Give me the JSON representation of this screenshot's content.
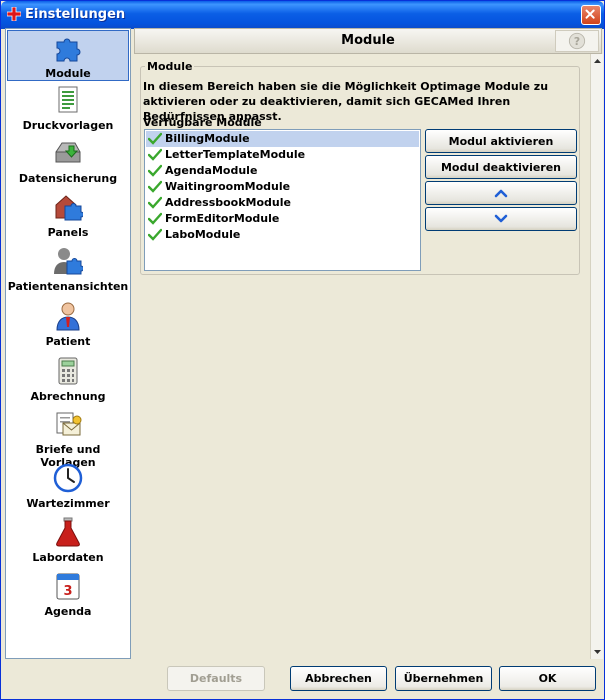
{
  "window": {
    "title": "Einstellungen"
  },
  "sidebar": {
    "items": [
      {
        "label": "Module",
        "icon": "puzzle-icon",
        "selected": true
      },
      {
        "label": "Druckvorlagen",
        "icon": "document-template-icon"
      },
      {
        "label": "Datensicherung",
        "icon": "backup-drive-icon"
      },
      {
        "label": "Panels",
        "icon": "panels-icon"
      },
      {
        "label": "Patientenansichten",
        "icon": "patient-views-icon"
      },
      {
        "label": "Patient",
        "icon": "patient-icon"
      },
      {
        "label": "Abrechnung",
        "icon": "calculator-icon"
      },
      {
        "label": "Briefe und Vorlagen",
        "icon": "letter-icon"
      },
      {
        "label": "Wartezimmer",
        "icon": "clock-icon"
      },
      {
        "label": "Labordaten",
        "icon": "flask-icon"
      },
      {
        "label": "Agenda",
        "icon": "calendar-icon"
      }
    ]
  },
  "header": {
    "title": "Module",
    "help_symbol": "?"
  },
  "module_section": {
    "legend": "Module",
    "description": "In diesem Bereich haben sie die Möglichkeit Optimage Module zu aktivieren oder zu deaktivieren, damit sich GECAMed Ihren Bedürfnissen anpasst.",
    "list_label": "Verfügbare Module",
    "modules": [
      {
        "name": "BillingModule",
        "active": true,
        "selected": true
      },
      {
        "name": "LetterTemplateModule",
        "active": true
      },
      {
        "name": "AgendaModule",
        "active": true
      },
      {
        "name": "WaitingroomModule",
        "active": true
      },
      {
        "name": "AddressbookModule",
        "active": true
      },
      {
        "name": "FormEditorModule",
        "active": true
      },
      {
        "name": "LaboModule",
        "active": true
      }
    ],
    "activate_label": "Modul aktivieren",
    "deactivate_label": "Modul deaktivieren"
  },
  "footer": {
    "defaults_label": "Defaults",
    "cancel_label": "Abbrechen",
    "apply_label": "Übernehmen",
    "ok_label": "OK"
  },
  "colors": {
    "titlebar": "#0453de",
    "selection": "#c1d2ee",
    "check": "#3aa82d",
    "arrow": "#1f5fd6"
  }
}
